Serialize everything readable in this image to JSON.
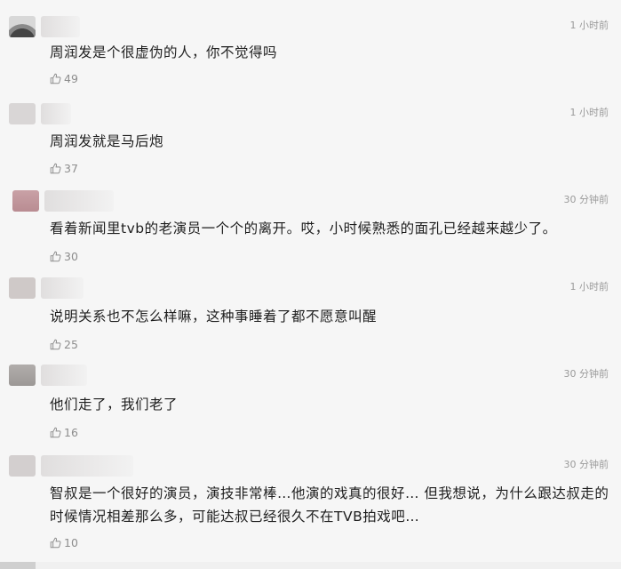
{
  "comments": [
    {
      "time": "1 小时前",
      "text": "周润发是个很虚伪的人，你不觉得吗",
      "likes": "49",
      "avatar_color": "#6b6b6b"
    },
    {
      "time": "1 小时前",
      "text": "周润发就是马后炮",
      "likes": "37",
      "avatar_color": "#d9d6d6"
    },
    {
      "time": "30 分钟前",
      "text": "看着新闻里tvb的老演员一个个的离开。哎，小时候熟悉的面孔已经越来越少了。",
      "likes": "30",
      "avatar_color": "#c9a1a6"
    },
    {
      "time": "1 小时前",
      "text": "说明关系也不怎么样嘛，这种事睡着了都不愿意叫醒",
      "likes": "25",
      "avatar_color": "#cfc9c8"
    },
    {
      "time": "30 分钟前",
      "text": "他们走了，我们老了",
      "likes": "16",
      "avatar_color": "#a8a4a2"
    },
    {
      "time": "30 分钟前",
      "text": "智叔是一个很好的演员，演技非常棒…他演的戏真的很好… 但我想说，为什么跟达叔走的时候情况相差那么多，可能达叔已经很久不在TVB拍戏吧…",
      "likes": "10",
      "avatar_color": "#d3cfcf"
    }
  ]
}
